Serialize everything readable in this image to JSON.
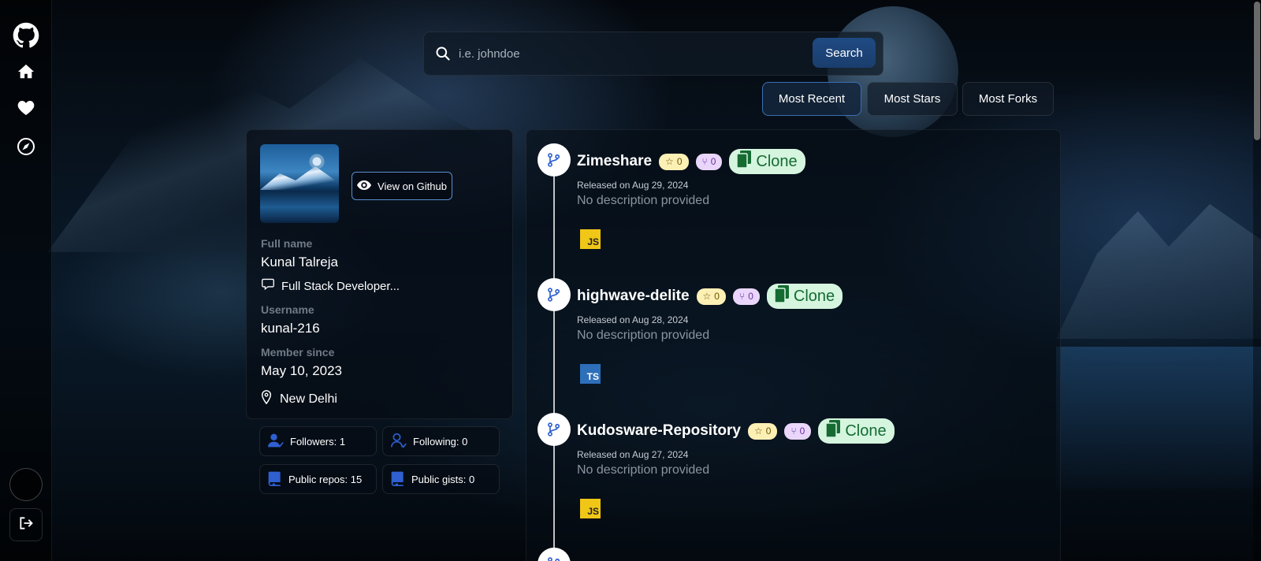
{
  "sidebar": {
    "icons": [
      "github-icon",
      "home-icon",
      "heart-icon",
      "compass-icon",
      "avatar",
      "logout-icon"
    ]
  },
  "search": {
    "placeholder": "i.e. johndoe",
    "button_label": "Search"
  },
  "sort_tabs": [
    {
      "label": "Most Recent",
      "active": true
    },
    {
      "label": "Most Stars",
      "active": false
    },
    {
      "label": "Most Forks",
      "active": false
    }
  ],
  "profile": {
    "view_button": "View on Github",
    "full_name_label": "Full name",
    "full_name": "Kunal Talreja",
    "bio": "Full Stack Developer...",
    "username_label": "Username",
    "username": "kunal-216",
    "member_since_label": "Member since",
    "member_since": "May 10, 2023",
    "location": "New Delhi"
  },
  "stats": {
    "followers": "Followers: 1",
    "following": "Following: 0",
    "public_repos": "Public repos: 15",
    "public_gists": "Public gists: 0"
  },
  "repos": [
    {
      "name": "Zimeshare",
      "stars": "0",
      "forks": "0",
      "clone": "Clone",
      "released": "Released on Aug 29, 2024",
      "description": "No description provided",
      "language": "JS"
    },
    {
      "name": "highwave-delite",
      "stars": "0",
      "forks": "0",
      "clone": "Clone",
      "released": "Released on Aug 28, 2024",
      "description": "No description provided",
      "language": "TS"
    },
    {
      "name": "Kudosware-Repository",
      "stars": "0",
      "forks": "0",
      "clone": "Clone",
      "released": "Released on Aug 27, 2024",
      "description": "No description provided",
      "language": "JS"
    }
  ],
  "colors": {
    "accent": "#1f4a82",
    "star_pill": "#fdf0b5",
    "fork_pill": "#ead6fb",
    "clone_pill": "#d5f5df",
    "js": "#f0c617",
    "ts": "#2e6fba"
  }
}
